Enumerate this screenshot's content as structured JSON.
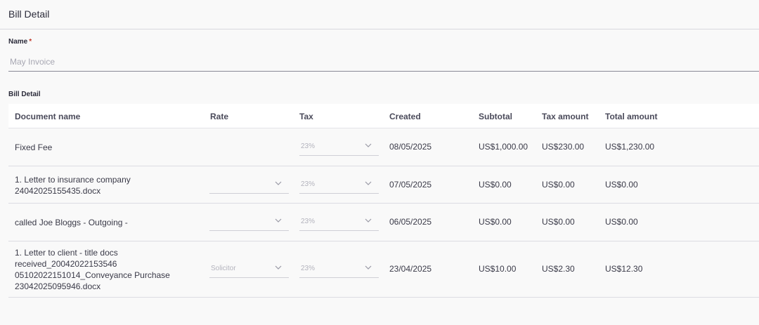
{
  "header": {
    "title": "Bill Detail"
  },
  "name_field": {
    "label": "Name",
    "required_mark": "*",
    "placeholder": "May Invoice",
    "value": ""
  },
  "section": {
    "label": "Bill Detail"
  },
  "table": {
    "columns": [
      "Document name",
      "Rate",
      "Tax",
      "Created",
      "Subtotal",
      "Tax amount",
      "Total amount"
    ],
    "rows": [
      {
        "doc_lines": [
          "Fixed Fee"
        ],
        "rate": null,
        "tax": "23%",
        "created": "08/05/2025",
        "subtotal": "US$1,000.00",
        "tax_amount": "US$230.00",
        "total": "US$1,230.00"
      },
      {
        "doc_lines": [
          "1. Letter to insurance company",
          "24042025155435.docx"
        ],
        "rate": "",
        "tax": "23%",
        "created": "07/05/2025",
        "subtotal": "US$0.00",
        "tax_amount": "US$0.00",
        "total": "US$0.00"
      },
      {
        "doc_lines": [
          "called Joe Bloggs - Outgoing -"
        ],
        "rate": "",
        "tax": "23%",
        "created": "06/05/2025",
        "subtotal": "US$0.00",
        "tax_amount": "US$0.00",
        "total": "US$0.00"
      },
      {
        "doc_lines": [
          "1. Letter to client - title docs",
          "received_20042022153546",
          "05102022151014_Conveyance Purchase",
          "23042025095946.docx"
        ],
        "rate": "Solicitor",
        "tax": "23%",
        "created": "23/04/2025",
        "subtotal": "US$10.00",
        "tax_amount": "US$2.30",
        "total": "US$12.30"
      }
    ]
  },
  "icons": {
    "select_chevron": "chevron-down-icon"
  }
}
